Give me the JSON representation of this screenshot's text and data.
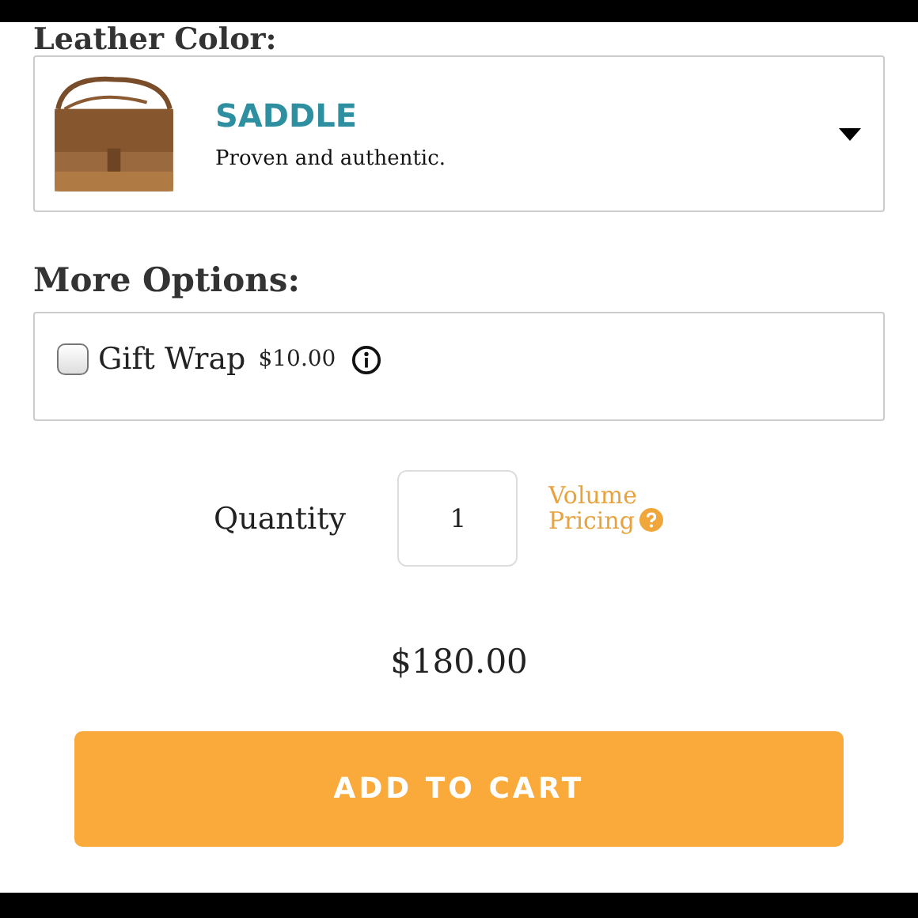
{
  "leather_color": {
    "heading": "Leather Color:",
    "selected_option": {
      "name": "SADDLE",
      "description": "Proven and authentic."
    }
  },
  "more_options": {
    "heading": "More Options:",
    "options": [
      {
        "label": "Gift Wrap",
        "price": "$10.00",
        "checked": false
      }
    ]
  },
  "quantity": {
    "label": "Quantity",
    "value": "1",
    "volume_pricing": "Volume Pricing"
  },
  "price": "$180.00",
  "add_to_cart": "ADD TO CART"
}
